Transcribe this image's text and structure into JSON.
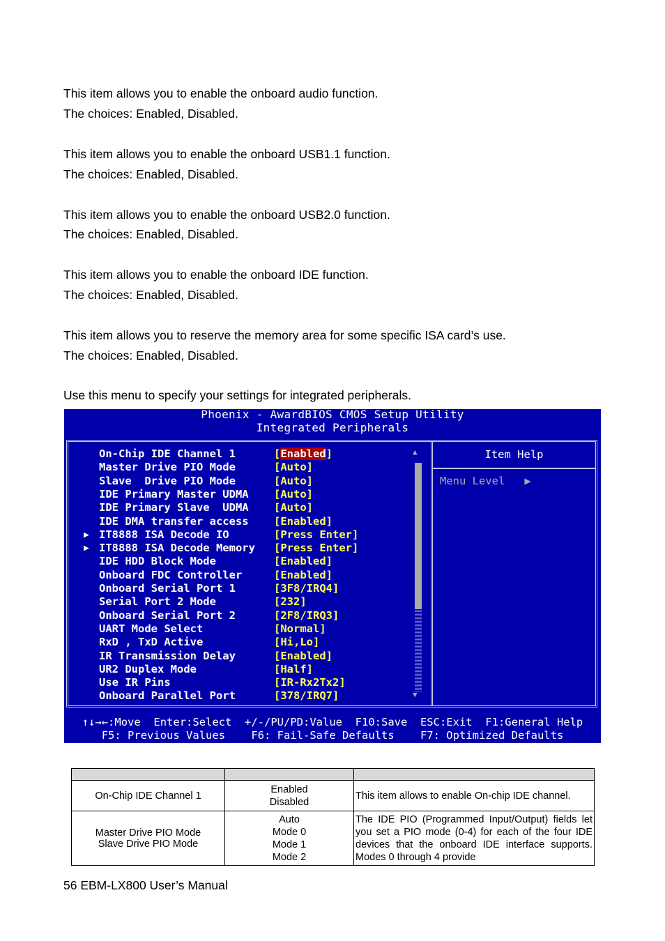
{
  "paragraphs": [
    {
      "text": "This item allows you to enable the onboard audio function.",
      "choices": "The choices: Enabled, Disabled."
    },
    {
      "text": "This item allows you to enable the onboard USB1.1 function.",
      "choices": "The choices: Enabled, Disabled."
    },
    {
      "text": "This item allows you to enable the onboard USB2.0 function.",
      "choices": "The choices: Enabled, Disabled."
    },
    {
      "text": "This item allows you to enable the onboard IDE function.",
      "choices": "The choices: Enabled, Disabled."
    },
    {
      "text": "This item allows you to reserve the memory area for some specific ISA card’s use.",
      "choices": "The choices: Enabled, Disabled."
    }
  ],
  "intro": "Use this menu to specify your settings for integrated peripherals.",
  "bios": {
    "title": "Phoenix - AwardBIOS CMOS Setup Utility",
    "subtitle": "Integrated Peripherals",
    "help_title": "Item Help",
    "menu_level": "Menu Level   ▶",
    "items": [
      {
        "label": "On-Chip IDE Channel 1",
        "value": "[Enabled]",
        "submenu": false,
        "selected": true
      },
      {
        "label": "Master Drive PIO Mode",
        "value": "[Auto]",
        "submenu": false
      },
      {
        "label": "Slave  Drive PIO Mode",
        "value": "[Auto]",
        "submenu": false
      },
      {
        "label": "IDE Primary Master UDMA",
        "value": "[Auto]",
        "submenu": false
      },
      {
        "label": "IDE Primary Slave  UDMA",
        "value": "[Auto]",
        "submenu": false
      },
      {
        "label": "IDE DMA transfer access",
        "value": "[Enabled]",
        "submenu": false
      },
      {
        "label": "IT8888 ISA Decode IO",
        "value": "[Press Enter]",
        "submenu": true
      },
      {
        "label": "IT8888 ISA Decode Memory",
        "value": "[Press Enter]",
        "submenu": true
      },
      {
        "label": "IDE HDD Block Mode",
        "value": "[Enabled]",
        "submenu": false
      },
      {
        "label": "Onboard FDC Controller",
        "value": "[Enabled]",
        "submenu": false
      },
      {
        "label": "Onboard Serial Port 1",
        "value": "[3F8/IRQ4]",
        "submenu": false
      },
      {
        "label": "Serial Port 2 Mode",
        "value": "[232]",
        "submenu": false
      },
      {
        "label": "Onboard Serial Port 2",
        "value": "[2F8/IRQ3]",
        "submenu": false
      },
      {
        "label": "UART Mode Select",
        "value": "[Normal]",
        "submenu": false
      },
      {
        "label": "RxD , TxD Active",
        "value": "[Hi,Lo]",
        "submenu": false
      },
      {
        "label": "IR Transmission Delay",
        "value": "[Enabled]",
        "submenu": false
      },
      {
        "label": "UR2 Duplex Mode",
        "value": "[Half]",
        "submenu": false
      },
      {
        "label": "Use IR Pins",
        "value": "[IR-Rx2Tx2]",
        "submenu": false
      },
      {
        "label": "Onboard Parallel Port",
        "value": "[378/IRQ7]",
        "submenu": false
      }
    ],
    "footer_line1": "↑↓→←:Move  Enter:Select  +/-/PU/PD:Value  F10:Save  ESC:Exit  F1:General Help",
    "footer_line2": "F5: Previous Values    F6: Fail-Safe Defaults    F7: Optimized Defaults",
    "colors": {
      "background": "#0000aa",
      "value": "#ffff55",
      "selected": "#aa0000",
      "dim": "#aaaaaa"
    }
  },
  "table": {
    "headers": [
      "",
      "",
      ""
    ],
    "rows": [
      {
        "item": [
          "On-Chip IDE Channel 1"
        ],
        "options": [
          "Enabled",
          "Disabled"
        ],
        "description": "This item allows to enable On-chip IDE channel."
      },
      {
        "item": [
          "Master Drive PIO Mode",
          "Slave Drive PIO Mode"
        ],
        "options": [
          "Auto",
          "Mode 0",
          "Mode 1",
          "Mode 2"
        ],
        "description": "The IDE PIO (Programmed Input/Output) fields let you set a PIO mode (0-4) for each of the four IDE devices that the onboard IDE interface supports. Modes 0 through 4 provide"
      }
    ]
  },
  "page_footer": "56 EBM-LX800 User’s Manual"
}
